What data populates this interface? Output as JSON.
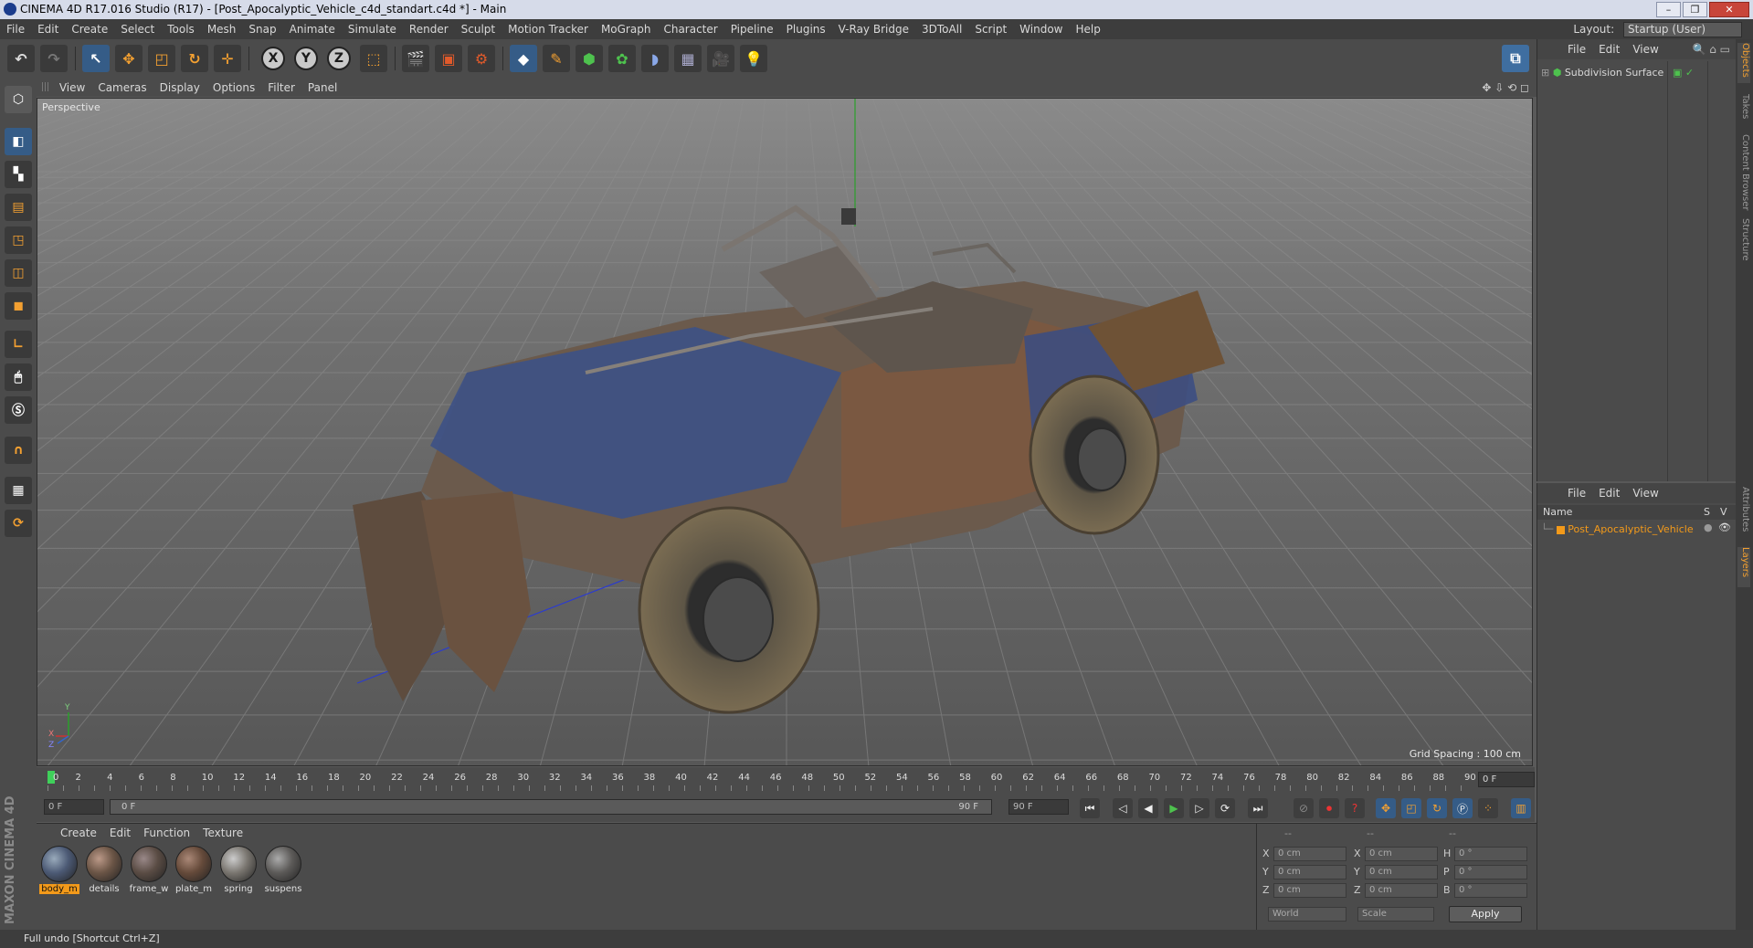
{
  "window": {
    "title": "CINEMA 4D R17.016 Studio (R17) - [Post_Apocalyptic_Vehicle_c4d_standart.c4d *] - Main"
  },
  "menubar": {
    "items": [
      "File",
      "Edit",
      "Create",
      "Select",
      "Tools",
      "Mesh",
      "Snap",
      "Animate",
      "Simulate",
      "Render",
      "Sculpt",
      "Motion Tracker",
      "MoGraph",
      "Character",
      "Pipeline",
      "Plugins",
      "V-Ray Bridge",
      "3DToAll",
      "Script",
      "Window",
      "Help"
    ]
  },
  "layout": {
    "label": "Layout:",
    "value": "Startup (User)"
  },
  "toolbar": {
    "axis_labels": [
      "X",
      "Y",
      "Z"
    ],
    "icons": [
      "undo-icon",
      "redo-icon",
      "select-icon",
      "move-icon",
      "scale-icon",
      "rotate-icon",
      "transform-icon",
      "x-axis-icon",
      "y-axis-icon",
      "z-axis-icon",
      "coordinate-system-icon",
      "render-view-icon",
      "render-picture-viewer-icon",
      "render-settings-icon",
      "cube-icon",
      "pen-icon",
      "subdivision-icon",
      "cloner-icon",
      "deformer-icon",
      "floor-icon",
      "camera-icon",
      "light-icon",
      "python-icon"
    ]
  },
  "viewport": {
    "menu": [
      "View",
      "Cameras",
      "Display",
      "Options",
      "Filter",
      "Panel"
    ],
    "label": "Perspective",
    "grid_spacing": "Grid Spacing : 100 cm",
    "axis_labels": {
      "y": "Y",
      "x": "X",
      "z": "Z"
    }
  },
  "timeline": {
    "ticks": [
      "0",
      "2",
      "4",
      "6",
      "8",
      "10",
      "12",
      "14",
      "16",
      "18",
      "20",
      "22",
      "24",
      "26",
      "28",
      "30",
      "32",
      "34",
      "36",
      "38",
      "40",
      "42",
      "44",
      "46",
      "48",
      "50",
      "52",
      "54",
      "56",
      "58",
      "60",
      "62",
      "64",
      "66",
      "68",
      "70",
      "72",
      "74",
      "76",
      "78",
      "80",
      "82",
      "84",
      "86",
      "88",
      "90"
    ],
    "current_frame": "0 F",
    "start_field": "0 F",
    "range_start": "0 F",
    "range_end": "90 F",
    "end_field": "90 F"
  },
  "materials": {
    "menu": [
      "Create",
      "Edit",
      "Function",
      "Texture"
    ],
    "items": [
      {
        "name": "body_m",
        "color": "#4c5a75",
        "selected": true
      },
      {
        "name": "details",
        "color": "#6b5546",
        "selected": false
      },
      {
        "name": "frame_w",
        "color": "#5a4c44",
        "selected": false
      },
      {
        "name": "plate_m",
        "color": "#654a3a",
        "selected": false
      },
      {
        "name": "spring",
        "color": "#7a7670",
        "selected": false
      },
      {
        "name": "suspens",
        "color": "#5c5a58",
        "selected": false
      }
    ]
  },
  "coordinates": {
    "headers": [
      "--",
      "--",
      "--"
    ],
    "rows": [
      {
        "a": "X",
        "av": "0 cm",
        "b": "X",
        "bv": "0 cm",
        "c": "H",
        "cv": "0 °"
      },
      {
        "a": "Y",
        "av": "0 cm",
        "b": "Y",
        "bv": "0 cm",
        "c": "P",
        "cv": "0 °"
      },
      {
        "a": "Z",
        "av": "0 cm",
        "b": "Z",
        "bv": "0 cm",
        "c": "B",
        "cv": "0 °"
      }
    ],
    "mode1": "World",
    "mode2": "Scale",
    "apply": "Apply"
  },
  "objects_panel": {
    "menu": [
      "File",
      "Edit",
      "View"
    ],
    "items": [
      {
        "name": "Subdivision Surface"
      }
    ]
  },
  "layers_panel": {
    "menu": [
      "File",
      "Edit",
      "View"
    ],
    "header": {
      "name": "Name",
      "s": "S",
      "v": "V"
    },
    "items": [
      {
        "name": "Post_Apocalyptic_Vehicle",
        "color": "#f39a1a"
      }
    ]
  },
  "side_tabs": [
    "Objects",
    "Takes",
    "Content Browser",
    "Structure",
    "Attributes",
    "Layers"
  ],
  "branding": "MAXON CINEMA 4D",
  "status": "Full undo [Shortcut Ctrl+Z]"
}
